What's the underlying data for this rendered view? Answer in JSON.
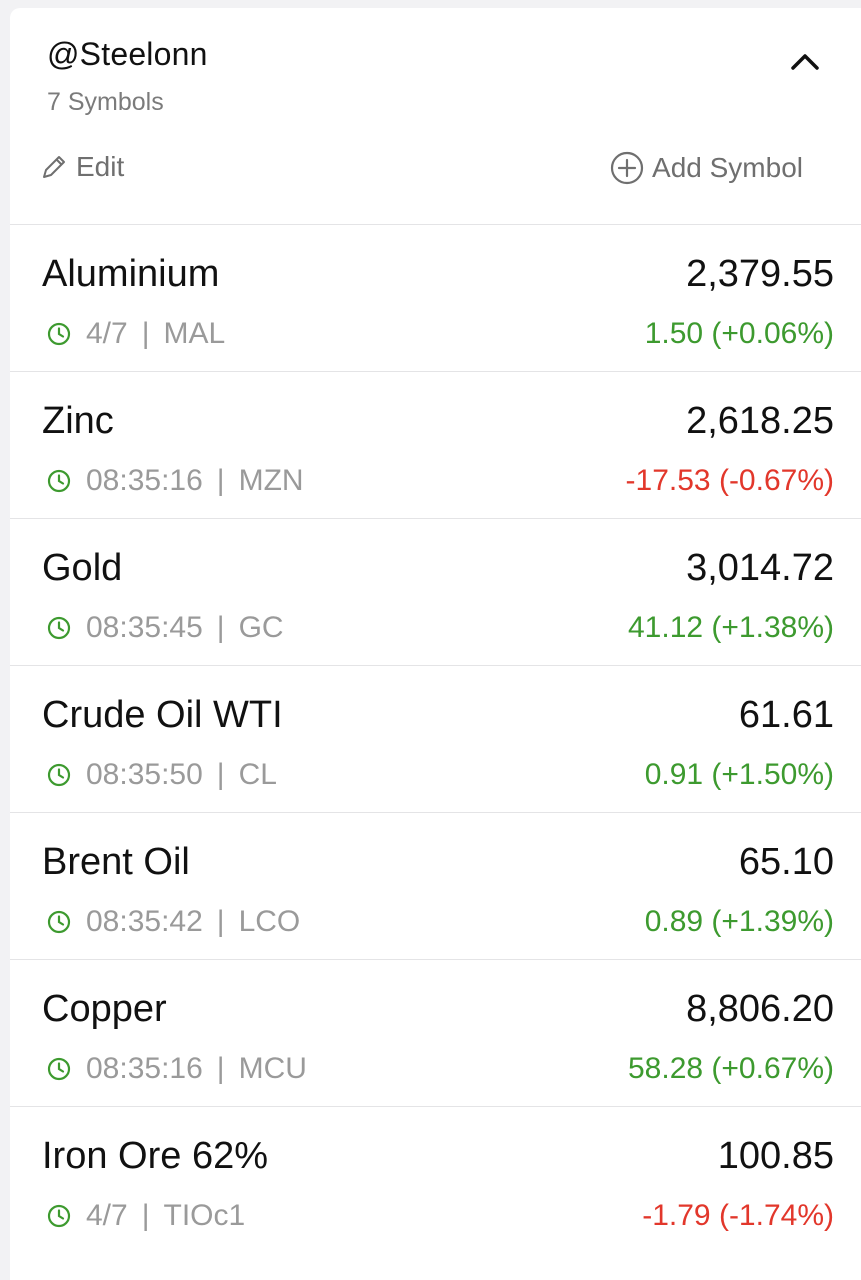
{
  "watchlist": {
    "owner": "@Steelonn",
    "count_label": "7 Symbols",
    "edit_label": "Edit",
    "add_label": "Add Symbol",
    "collapse_icon": "chevron-up-icon"
  },
  "colors": {
    "up": "#3d9a2f",
    "down": "#e2372b",
    "clock": "#3d9a2f"
  },
  "symbols": [
    {
      "name": "Aluminium",
      "price": "2,379.55",
      "time": "4/7",
      "code": "MAL",
      "change": "1.50",
      "change_pct": "(+0.06%)",
      "direction": "up"
    },
    {
      "name": "Zinc",
      "price": "2,618.25",
      "time": "08:35:16",
      "code": "MZN",
      "change": "-17.53",
      "change_pct": "(-0.67%)",
      "direction": "down"
    },
    {
      "name": "Gold",
      "price": "3,014.72",
      "time": "08:35:45",
      "code": "GC",
      "change": "41.12",
      "change_pct": "(+1.38%)",
      "direction": "up"
    },
    {
      "name": "Crude Oil WTI",
      "price": "61.61",
      "time": "08:35:50",
      "code": "CL",
      "change": "0.91",
      "change_pct": "(+1.50%)",
      "direction": "up"
    },
    {
      "name": "Brent Oil",
      "price": "65.10",
      "time": "08:35:42",
      "code": "LCO",
      "change": "0.89",
      "change_pct": "(+1.39%)",
      "direction": "up"
    },
    {
      "name": "Copper",
      "price": "8,806.20",
      "time": "08:35:16",
      "code": "MCU",
      "change": "58.28",
      "change_pct": "(+0.67%)",
      "direction": "up"
    },
    {
      "name": "Iron Ore 62%",
      "price": "100.85",
      "time": "4/7",
      "code": "TIOc1",
      "change": "-1.79",
      "change_pct": "(-1.74%)",
      "direction": "down"
    }
  ]
}
